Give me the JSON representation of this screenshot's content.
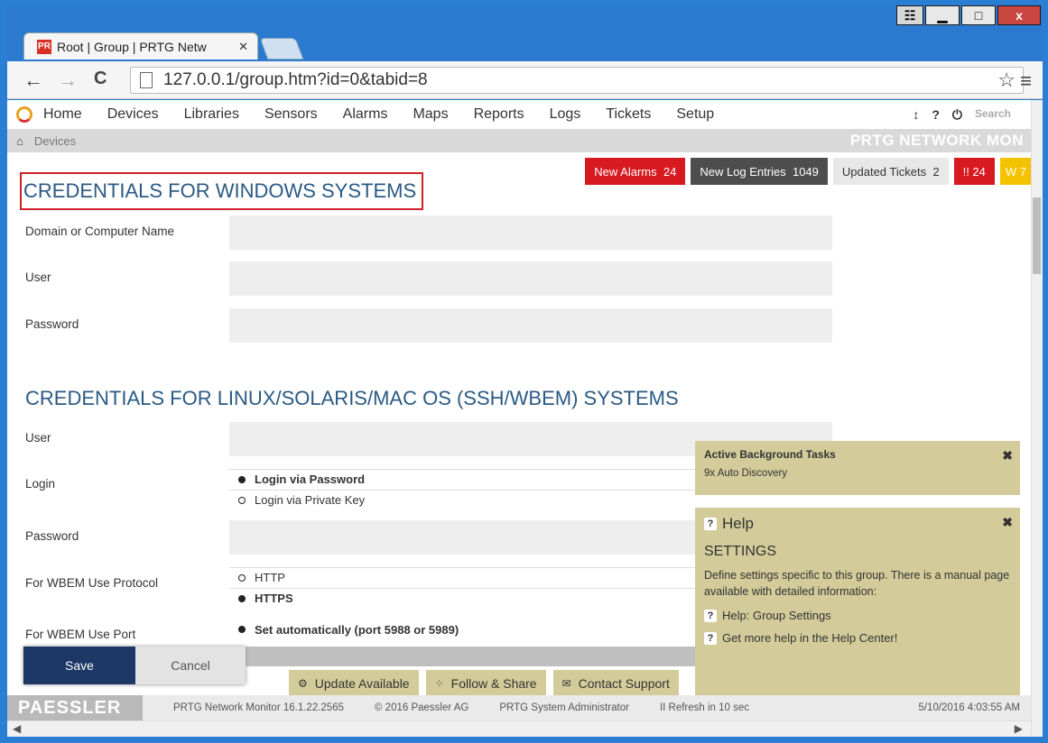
{
  "window": {
    "user_btn": "☷",
    "minimize": "▁",
    "maximize": "□",
    "close": "x"
  },
  "browser": {
    "tab_title": "Root | Group | PRTG Netw",
    "tab_close": "✕",
    "favicon_text": "PR",
    "url": "127.0.0.1/group.htm?id=0&tabid=8",
    "back": "←",
    "forward": "→",
    "reload": "C",
    "star": "☆",
    "menu": "≡"
  },
  "mainnav": {
    "items": [
      "Home",
      "Devices",
      "Libraries",
      "Sensors",
      "Alarms",
      "Maps",
      "Reports",
      "Logs",
      "Tickets",
      "Setup"
    ],
    "icons": [
      "↕",
      "?",
      "⏻"
    ],
    "search_placeholder": "Search"
  },
  "breadcrumb": {
    "home_icon": "⌂",
    "item": "Devices",
    "brand": "PRTG NETWORK MON"
  },
  "badges": {
    "new_alarms_label": "New Alarms",
    "new_alarms_count": "24",
    "new_log_label": "New Log Entries",
    "new_log_count": "1049",
    "updated_tickets_label": "Updated Tickets",
    "updated_tickets_count": "2",
    "errors": "!! 24",
    "warnings": "W 7"
  },
  "windows_section": {
    "title": "CREDENTIALS FOR WINDOWS SYSTEMS",
    "domain_label": "Domain or Computer Name",
    "user_label": "User",
    "password_label": "Password"
  },
  "linux_section": {
    "title": "CREDENTIALS FOR LINUX/SOLARIS/MAC OS (SSH/WBEM) SYSTEMS",
    "user_label": "User",
    "login_label": "Login",
    "login_opt1": "Login via Password",
    "login_opt2": "Login via Private Key",
    "password_label": "Password",
    "wbem_protocol_label": "For WBEM Use Protocol",
    "protocol_opt1": "HTTP",
    "protocol_opt2": "HTTPS",
    "wbem_port_label": "For WBEM Use Port",
    "port_opt1": "Set automatically (port 5988 or 5989)"
  },
  "bg_tasks": {
    "title": "Active Background Tasks",
    "item": "9x Auto Discovery",
    "close": "✖"
  },
  "help": {
    "head": "Help",
    "title": "SETTINGS",
    "text": "Define settings specific to this group. There is a manual page available with detailed information:",
    "link1": "Help: Group Settings",
    "link2": "Get more help in the Help Center!",
    "close": "✖"
  },
  "actions": {
    "save": "Save",
    "cancel": "Cancel"
  },
  "footer": {
    "update": "Update Available",
    "follow": "Follow & Share",
    "contact": "Contact Support"
  },
  "statusbar": {
    "brand": "PAESSLER",
    "version": "PRTG Network Monitor 16.1.22.2565",
    "copyright": "© 2016 Paessler AG",
    "user": "PRTG System Administrator",
    "refresh": "II Refresh in 10 sec",
    "datetime": "5/10/2016 4:03:55 AM"
  },
  "colors": {
    "accent_red": "#d71920",
    "title_blue": "#2b5a84",
    "save_navy": "#1d3766",
    "panel_khaki": "#d3cc9a"
  }
}
